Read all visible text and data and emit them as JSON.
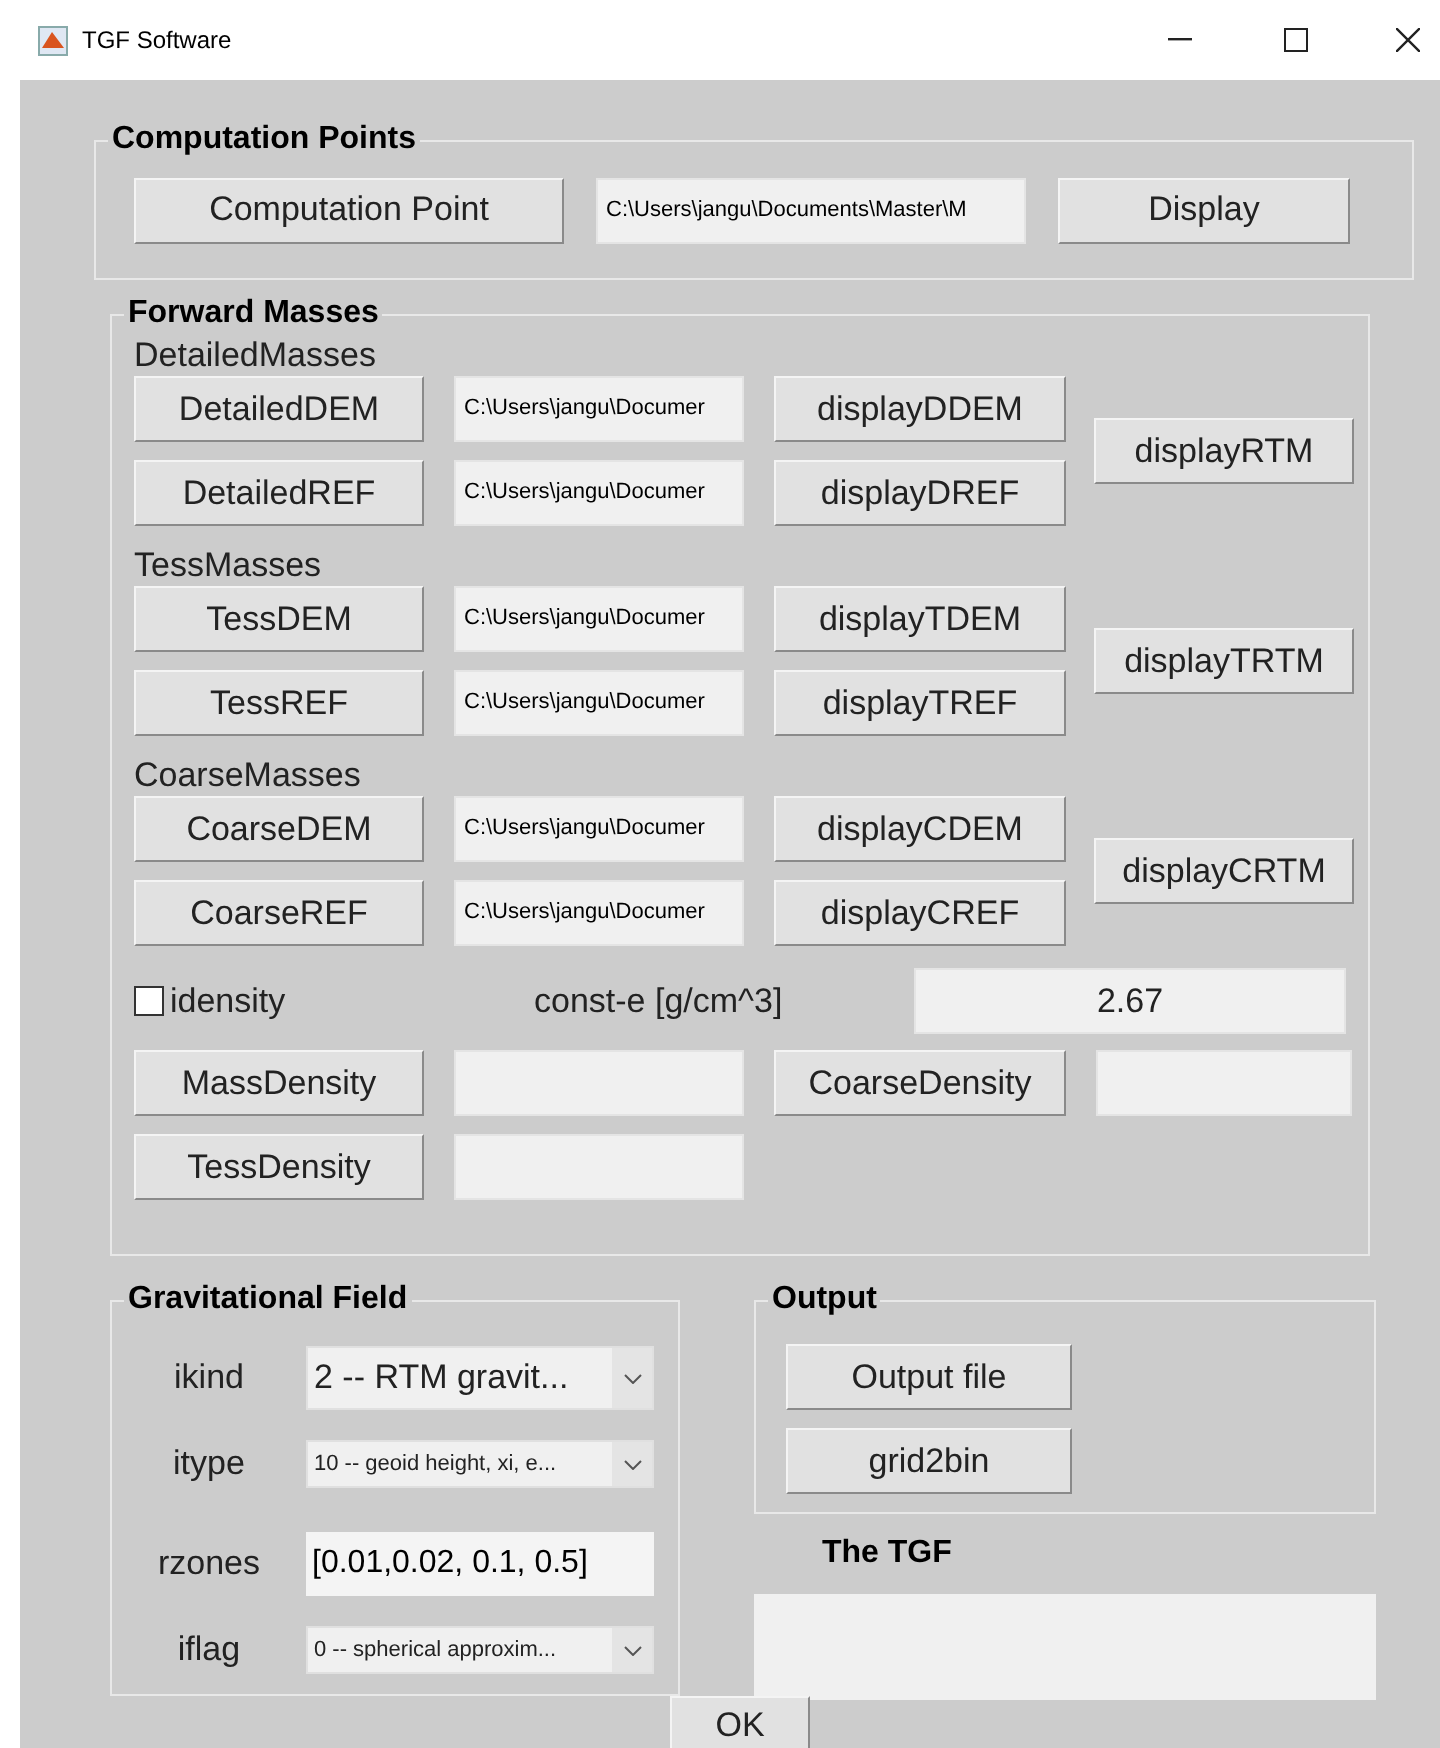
{
  "window": {
    "title": "TGF Software"
  },
  "computation_points": {
    "title": "Computation Points",
    "button": "Computation Point",
    "path": "C:\\Users\\jangu\\Documents\\Master\\M",
    "display_button": "Display"
  },
  "forward_masses": {
    "title": "Forward Masses",
    "groups": [
      {
        "label": "DetailedMasses",
        "rows": [
          {
            "button": "DetailedDEM",
            "path": "C:\\Users\\jangu\\Documer",
            "display_button": "displayDDEM"
          },
          {
            "button": "DetailedREF",
            "path": "C:\\Users\\jangu\\Documer",
            "display_button": "displayDREF"
          }
        ],
        "rtm_button": "displayRTM"
      },
      {
        "label": "TessMasses",
        "rows": [
          {
            "button": "TessDEM",
            "path": "C:\\Users\\jangu\\Documer",
            "display_button": "displayTDEM"
          },
          {
            "button": "TessREF",
            "path": "C:\\Users\\jangu\\Documer",
            "display_button": "displayTREF"
          }
        ],
        "rtm_button": "displayTRTM"
      },
      {
        "label": "CoarseMasses",
        "rows": [
          {
            "button": "CoarseDEM",
            "path": "C:\\Users\\jangu\\Documer",
            "display_button": "displayCDEM"
          },
          {
            "button": "CoarseREF",
            "path": "C:\\Users\\jangu\\Documer",
            "display_button": "displayCREF"
          }
        ],
        "rtm_button": "displayCRTM"
      }
    ],
    "idensity": {
      "label": "idensity",
      "checked": false
    },
    "const_label": "const-e [g/cm^3]",
    "const_value": "2.67",
    "density_buttons": [
      "MassDensity",
      "CoarseDensity",
      "TessDensity"
    ]
  },
  "gravitational_field": {
    "title": "Gravitational Field",
    "params": [
      {
        "label": "ikind",
        "kind": "dropdown",
        "value": "2 -- RTM gravit...",
        "large": true
      },
      {
        "label": "itype",
        "kind": "dropdown",
        "value": "10 -- geoid height, xi, e...",
        "large": false
      },
      {
        "label": "rzones",
        "kind": "field",
        "value": "[0.01,0.02, 0.1, 0.5]",
        "large": true
      },
      {
        "label": "iflag",
        "kind": "dropdown",
        "value": "0 -- spherical approxim...",
        "large": false
      }
    ]
  },
  "output": {
    "title": "Output",
    "buttons": [
      "Output file",
      "grid2bin"
    ]
  },
  "result_label": "The TGF",
  "ok_button": "OK"
}
